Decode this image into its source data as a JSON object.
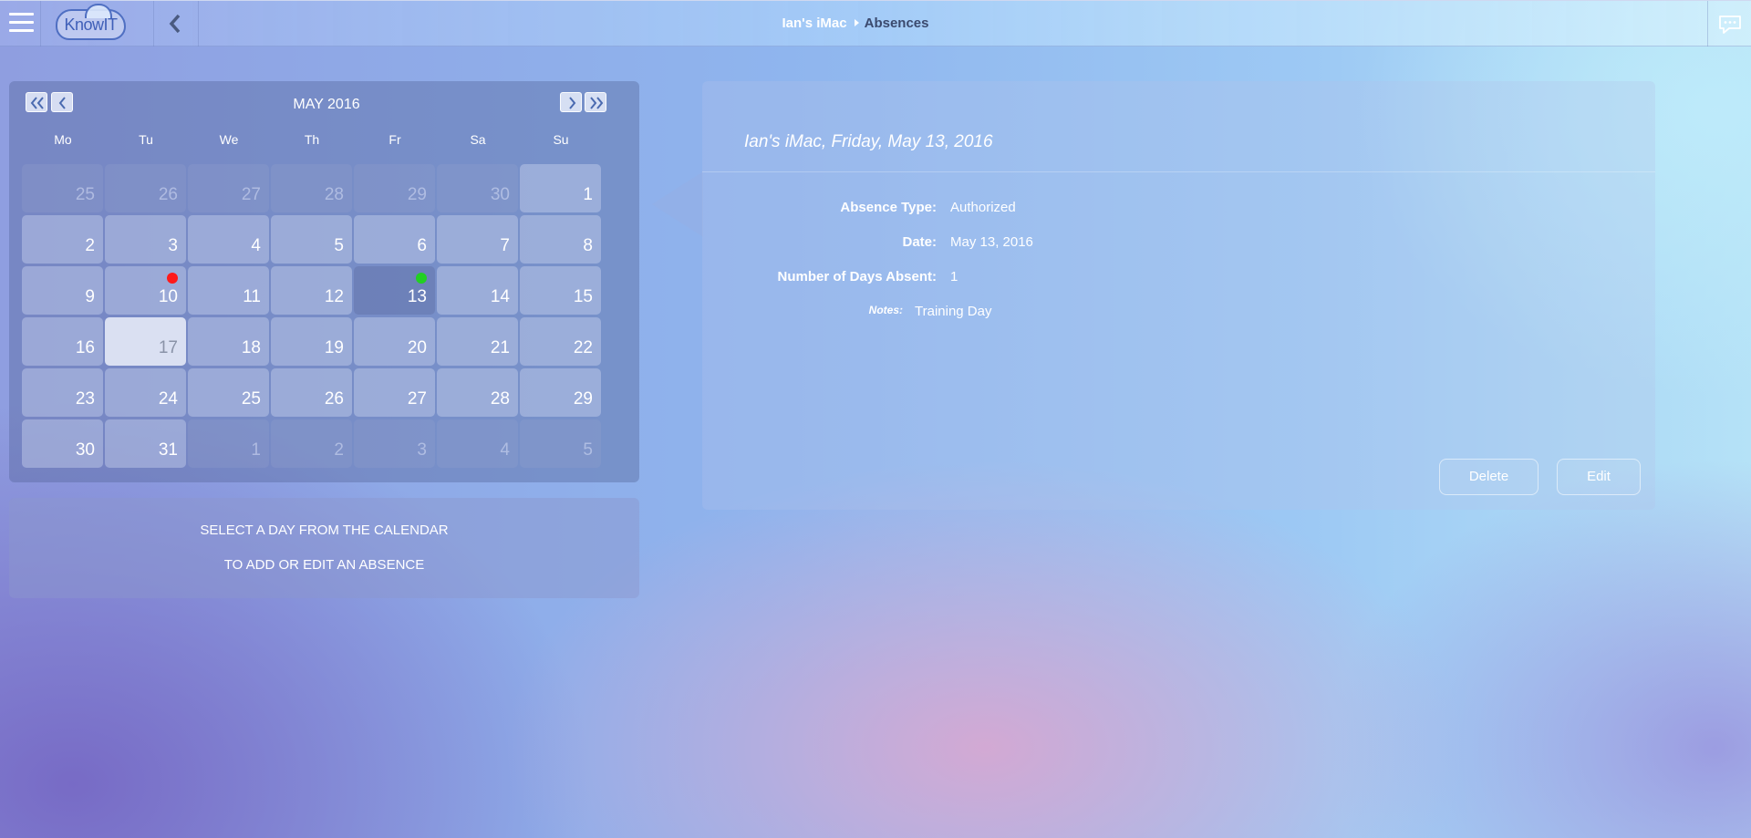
{
  "header": {
    "logo_text": "KnowIT",
    "breadcrumb": {
      "host": "Ian's iMac",
      "current": "Absences"
    }
  },
  "calendar": {
    "month_title": "MAY 2016",
    "weekdays": [
      "Mo",
      "Tu",
      "We",
      "Th",
      "Fr",
      "Sa",
      "Su"
    ],
    "weeks": [
      [
        {
          "n": "25",
          "muted": true
        },
        {
          "n": "26",
          "muted": true
        },
        {
          "n": "27",
          "muted": true
        },
        {
          "n": "28",
          "muted": true
        },
        {
          "n": "29",
          "muted": true
        },
        {
          "n": "30",
          "muted": true
        },
        {
          "n": "1"
        }
      ],
      [
        {
          "n": "2"
        },
        {
          "n": "3"
        },
        {
          "n": "4"
        },
        {
          "n": "5"
        },
        {
          "n": "6"
        },
        {
          "n": "7"
        },
        {
          "n": "8"
        }
      ],
      [
        {
          "n": "9"
        },
        {
          "n": "10",
          "dot": "#ff1a1a"
        },
        {
          "n": "11"
        },
        {
          "n": "12"
        },
        {
          "n": "13",
          "dot": "#22d022",
          "selected": true
        },
        {
          "n": "14"
        },
        {
          "n": "15"
        }
      ],
      [
        {
          "n": "16"
        },
        {
          "n": "17",
          "today": true
        },
        {
          "n": "18"
        },
        {
          "n": "19"
        },
        {
          "n": "20"
        },
        {
          "n": "21"
        },
        {
          "n": "22"
        }
      ],
      [
        {
          "n": "23"
        },
        {
          "n": "24"
        },
        {
          "n": "25"
        },
        {
          "n": "26"
        },
        {
          "n": "27"
        },
        {
          "n": "28"
        },
        {
          "n": "29"
        }
      ],
      [
        {
          "n": "30"
        },
        {
          "n": "31"
        },
        {
          "n": "1",
          "muted": true
        },
        {
          "n": "2",
          "muted": true
        },
        {
          "n": "3",
          "muted": true
        },
        {
          "n": "4",
          "muted": true
        },
        {
          "n": "5",
          "muted": true
        }
      ]
    ]
  },
  "hint": {
    "line1": "SELECT A DAY FROM THE CALENDAR",
    "line2": "TO ADD OR EDIT AN ABSENCE"
  },
  "detail": {
    "title": "Ian's iMac, Friday, May 13, 2016",
    "fields": [
      {
        "label": "Absence Type:",
        "value": "Authorized"
      },
      {
        "label": "Date:",
        "value": "May 13, 2016"
      },
      {
        "label": "Number of Days Absent:",
        "value": "1"
      }
    ],
    "notes_label": "Notes:",
    "notes_value": "Training Day",
    "delete_label": "Delete",
    "edit_label": "Edit"
  },
  "colors": {
    "absence_unauthorized_dot": "#ff1a1a",
    "absence_authorized_dot": "#22d022"
  }
}
